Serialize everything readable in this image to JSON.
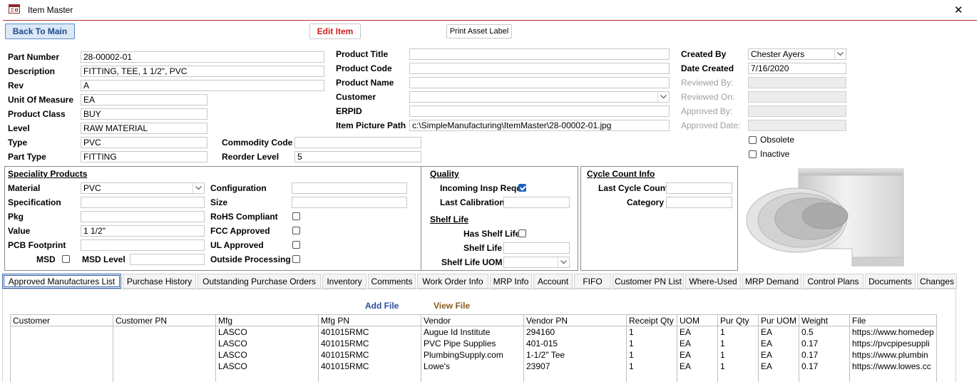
{
  "window": {
    "title": "Item Master",
    "close": "✕"
  },
  "toolbar": {
    "back": "Back To Main",
    "edit": "Edit Item",
    "print": "Print Asset Label"
  },
  "general": {
    "part_number_label": "Part Number",
    "part_number": "28-00002-01",
    "description_label": "Description",
    "description": "FITTING, TEE, 1 1/2\", PVC",
    "rev_label": "Rev",
    "rev": "A",
    "uom_label": "Unit Of Measure",
    "uom": "EA",
    "product_class_label": "Product Class",
    "product_class": "BUY",
    "level_label": "Level",
    "level": "RAW MATERIAL",
    "type_label": "Type",
    "type": "PVC",
    "part_type_label": "Part Type",
    "part_type": "FITTING",
    "commodity_code_label": "Commodity Code",
    "commodity_code": "",
    "reorder_level_label": "Reorder Level",
    "reorder_level": "5"
  },
  "product": {
    "title_label": "Product Title",
    "title": "",
    "code_label": "Product Code",
    "code": "",
    "name_label": "Product Name",
    "name": "",
    "customer_label": "Customer",
    "customer": "",
    "erpid_label": "ERPID",
    "erpid": "",
    "picture_path_label": "Item Picture Path",
    "picture_path": "c:\\SimpleManufacturing\\ItemMaster\\28-00002-01.jpg"
  },
  "audit": {
    "created_by_label": "Created By",
    "created_by": "Chester Ayers",
    "date_created_label": "Date Created",
    "date_created": "7/16/2020",
    "reviewed_by_label": "Reviewed By:",
    "reviewed_on_label": "Reviewed On:",
    "approved_by_label": "Approved By:",
    "approved_date_label": "Approved Date:",
    "obsolete_label": "Obsolete",
    "inactive_label": "Inactive"
  },
  "speciality": {
    "heading": "Speciality Products",
    "material_label": "Material",
    "material": "PVC",
    "specification_label": "Specification",
    "specification": "",
    "pkg_label": "Pkg",
    "pkg": "",
    "value_label": "Value",
    "value": "1 1/2\"",
    "pcb_label": "PCB Footprint",
    "pcb": "",
    "msd_label": "MSD",
    "msd_level_label": "MSD Level",
    "msd_level": "",
    "configuration_label": "Configuration",
    "configuration": "",
    "size_label": "Size",
    "size": "",
    "rohs_label": "RoHS Compliant",
    "fcc_label": "FCC Approved",
    "ul_label": "UL Approved",
    "outside_label": "Outside Processing"
  },
  "quality": {
    "heading": "Quality",
    "insp_label": "Incoming Insp Reqd",
    "last_cal_label": "Last Calibration",
    "last_cal": "",
    "shelf_heading": "Shelf Life",
    "has_shelf_label": "Has Shelf Life",
    "shelf_life_label": "Shelf Life",
    "shelf_life": "",
    "shelf_uom_label": "Shelf Life UOM",
    "shelf_uom": ""
  },
  "cycle": {
    "heading": "Cycle Count Info",
    "last_label": "Last Cycle Count",
    "last": "",
    "category_label": "Category",
    "category": ""
  },
  "tabs": [
    "Approved Manufactures List",
    "Purchase History",
    "Outstanding Purchase Orders",
    "Inventory",
    "Comments",
    "Work Order Info",
    "MRP Info",
    "Account",
    "FIFO",
    "Customer PN List",
    "Where-Used",
    "MRP Demand",
    "Control Plans",
    "Documents",
    "Changes"
  ],
  "actions": {
    "add_file": "Add File",
    "view_file": "View File"
  },
  "table": {
    "headers": [
      "Customer",
      "Customer PN",
      "Mfg",
      "Mfg PN",
      "Vendor",
      "Vendor PN",
      "Receipt Qty",
      "UOM",
      "Pur Qty",
      "Pur UOM",
      "Weight",
      "File"
    ],
    "rows": [
      [
        "",
        "",
        "LASCO",
        "401015RMC",
        "Augue Id Institute",
        "294160",
        "1",
        "EA",
        "1",
        "EA",
        "0.5",
        "https://www.homedep"
      ],
      [
        "",
        "",
        "LASCO",
        "401015RMC",
        "PVC Pipe Supplies",
        "401-015",
        "1",
        "EA",
        "1",
        "EA",
        "0.17",
        "https://pvcpipesuppli"
      ],
      [
        "",
        "",
        "LASCO",
        "401015RMC",
        "PlumbingSupply.com",
        "1-1/2\" Tee",
        "1",
        "EA",
        "1",
        "EA",
        "0.17",
        "https://www.plumbin"
      ],
      [
        "",
        "",
        "LASCO",
        "401015RMC",
        "Lowe's",
        "23907",
        "1",
        "EA",
        "1",
        "EA",
        "0.17",
        "https://www.lowes.cc"
      ]
    ]
  },
  "colors": {
    "accent": "#1a62c4",
    "title_rule": "#b03030",
    "edit_text": "#d02020",
    "link_blue": "#2a4ea0",
    "link_brown": "#8a5a1a"
  }
}
